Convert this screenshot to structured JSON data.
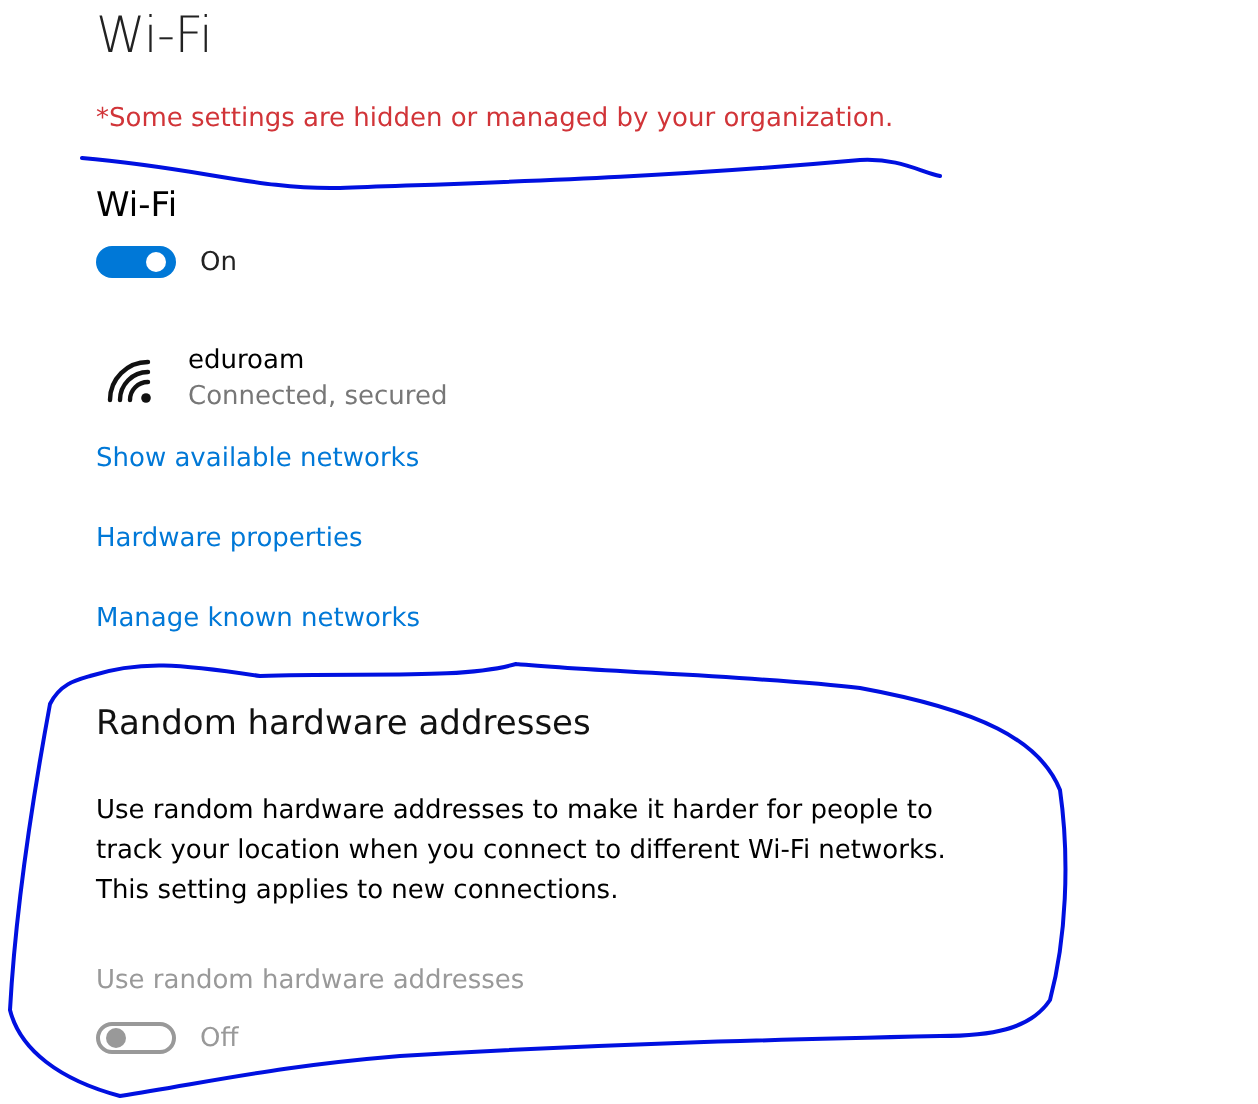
{
  "page": {
    "title": "Wi-Fi",
    "notice": "*Some settings are hidden or managed by your organization."
  },
  "wifi": {
    "heading": "Wi-Fi",
    "toggle": {
      "on": true,
      "disabled": false,
      "state_label": "On"
    }
  },
  "network": {
    "name": "eduroam",
    "status": "Connected, secured"
  },
  "links": [
    "Show available networks",
    "Hardware properties",
    "Manage known networks"
  ],
  "random_addresses": {
    "heading": "Random hardware addresses",
    "description": "Use random hardware addresses to make it harder for people to track your location when you connect to different Wi-Fi networks. This setting applies to new connections.",
    "label": "Use random hardware addresses",
    "toggle": {
      "on": false,
      "disabled": true,
      "state_label": "Off"
    }
  }
}
